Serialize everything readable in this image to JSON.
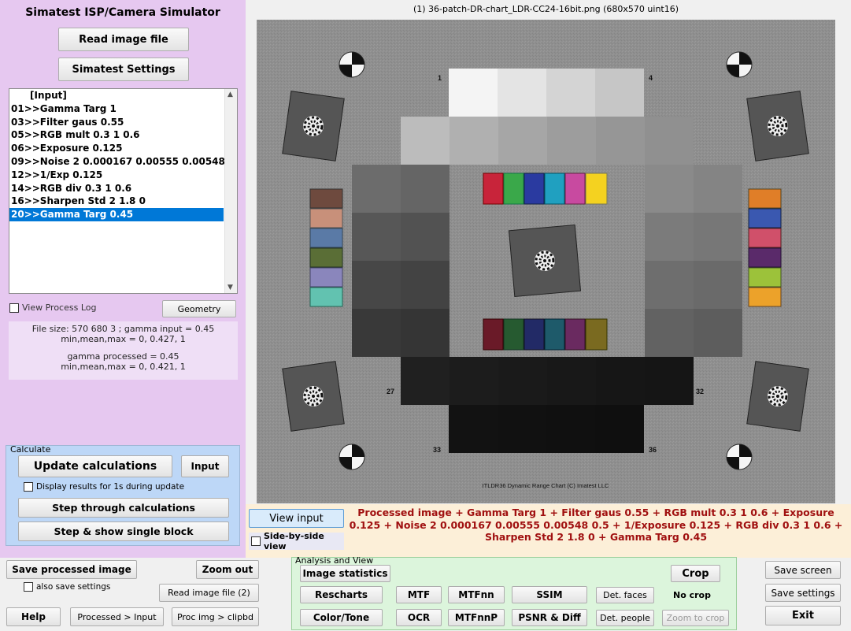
{
  "app": {
    "title": "Simatest ISP/Camera Simulator",
    "read_image_label": "Read image file",
    "settings_label": "Simatest Settings"
  },
  "process_list": {
    "header": "[Input]",
    "items": [
      "01>>Gamma Targ 1",
      "03>>Filter gaus 0.55",
      "05>>RGB mult 0.3 1 0.6",
      "06>>Exposure 0.125",
      "09>>Noise 2 0.000167 0.00555  0.00548 0.5",
      "12>>1/Exp 0.125",
      "14>>RGB div  0.3 1 0.6",
      "16>>Sharpen Std 2 1.8 0",
      "20>>Gamma Targ 0.45"
    ],
    "selected_index": 8
  },
  "left_controls": {
    "view_log_label": "View Process Log",
    "geometry_label": "Geometry"
  },
  "info": {
    "line1": "File size:  570  680    3 ;   gamma input = 0.45",
    "line2": "min,mean,max = 0, 0.427, 1",
    "line3": "gamma processed = 0.45",
    "line4": "min,mean,max = 0, 0.421, 1"
  },
  "calculate": {
    "legend": "Calculate",
    "update_label": "Update calculations",
    "input_label": "Input",
    "display_results_label": "Display results for 1s during update",
    "step_label": "Step through calculations",
    "step_single_label": "Step & show single block"
  },
  "image": {
    "title": "(1) 36-patch-DR-chart_LDR-CC24-16bit.png  (680x570  uint16)",
    "labels": {
      "p1": "1",
      "p4": "4",
      "p27": "27",
      "p32": "32",
      "p33": "33",
      "p36": "36"
    },
    "footer": "ITLDR36 Dynamic Range Chart (C) Imatest LLC"
  },
  "view": {
    "view_input_label": "View input",
    "side_by_side_label": "Side-by-side view",
    "caption": "Processed image  + Gamma Targ 1 + Filter gaus 0.55 + RGB mult 0.3 1 0.6 + Exposure 0.125 + Noise 2 0.000167 0.00555  0.00548 0.5 + 1/Exposure 0.125 + RGB div  0.3 1 0.6 + Sharpen Std 2 1.8 0 + Gamma Targ 0.45"
  },
  "bottom_left": {
    "save_processed_label": "Save processed image",
    "zoom_out_label": "Zoom out",
    "also_save_label": "also save settings",
    "read_image2_label": "Read image file (2)",
    "help_label": "Help",
    "processed_input_label": "Processed > Input",
    "proc_clipbd_label": "Proc img > clipbd"
  },
  "analysis": {
    "legend": "Analysis and View",
    "image_stats_label": "Image statistics",
    "crop_label": "Crop",
    "rescharts_label": "Rescharts",
    "mtf_label": "MTF",
    "mtfnn_label": "MTFnn",
    "ssim_label": "SSIM",
    "det_faces_label": "Det. faces",
    "no_crop_label": "No crop",
    "color_tone_label": "Color/Tone",
    "ocr_label": "OCR",
    "mtfnnp_label": "MTFnnP",
    "psnr_label": "PSNR & Diff",
    "det_people_label": "Det. people",
    "zoom_crop_label": "Zoom to crop"
  },
  "right_buttons": {
    "save_screen_label": "Save screen",
    "save_settings_label": "Save settings",
    "exit_label": "Exit"
  },
  "colors": {
    "left_panel_bg": "#e6c8f0",
    "calc_panel_bg": "#bdd7f7",
    "analysis_bg": "#dcf5dc",
    "caption_bg": "#fcefd8",
    "caption_text": "#a01010",
    "selection": "#0078d7"
  }
}
